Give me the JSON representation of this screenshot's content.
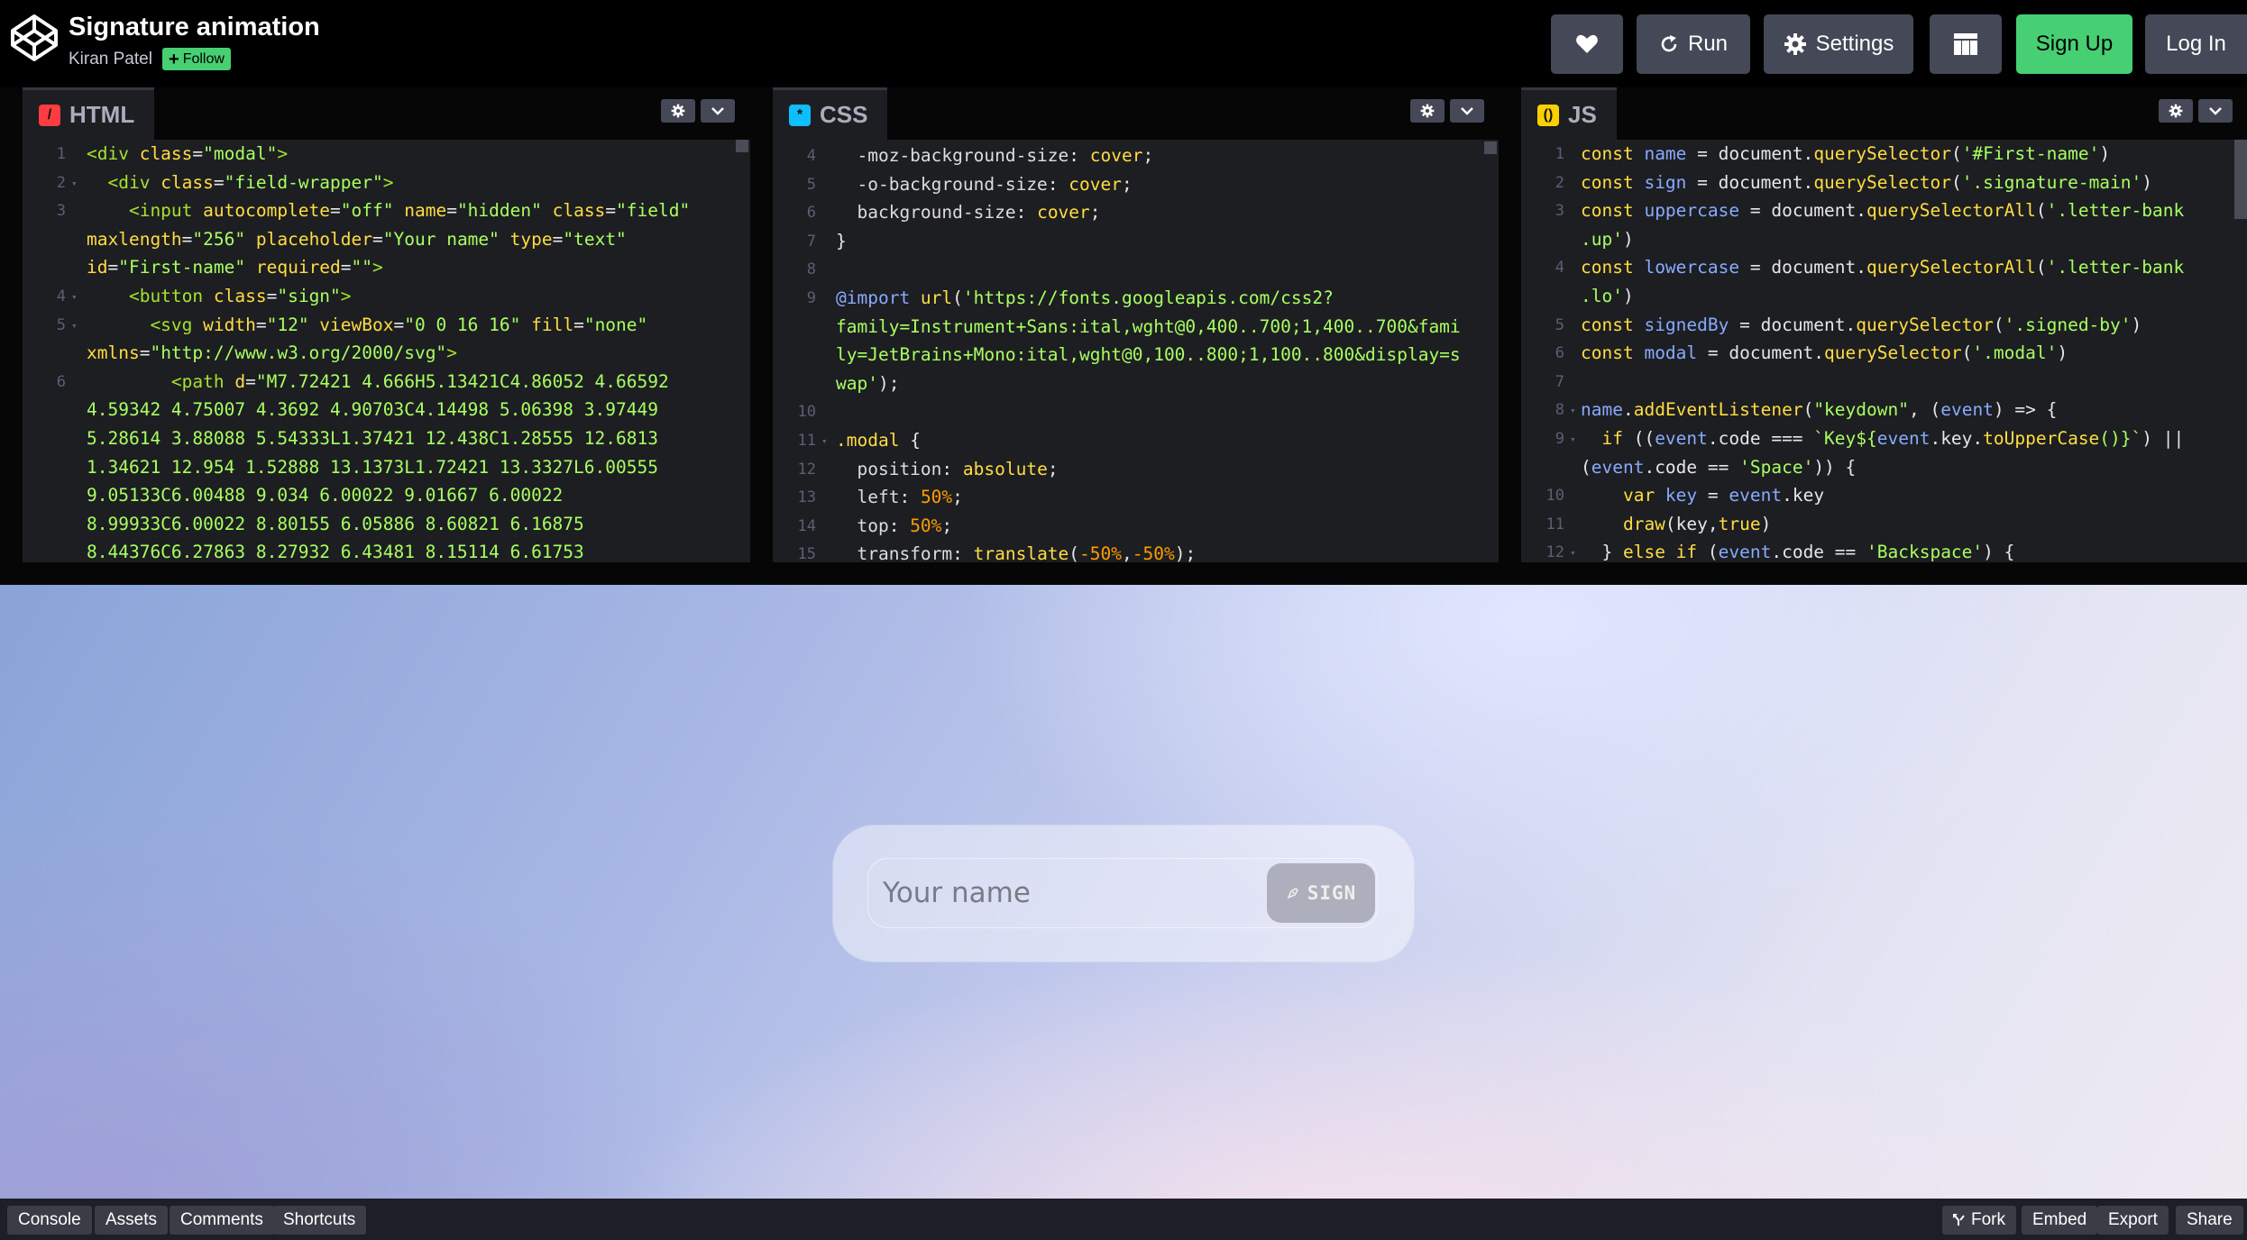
{
  "header": {
    "title": "Signature animation",
    "author": "Kiran Patel",
    "follow_label": "Follow",
    "buttons": {
      "run": "Run",
      "settings": "Settings",
      "signup": "Sign Up",
      "login": "Log In"
    },
    "accent": "#47cf73"
  },
  "editors": {
    "html": {
      "label": "HTML",
      "badge": "/",
      "lines": [
        {
          "n": "1",
          "fold": "",
          "segs": [
            [
              "<div ",
              "tk-tag"
            ],
            [
              "class",
              "tk-attr"
            ],
            [
              "=",
              ""
            ],
            [
              "\"modal\"",
              "tk-str"
            ],
            [
              ">",
              "tk-tag"
            ]
          ]
        },
        {
          "n": "2",
          "fold": "▾",
          "segs": [
            [
              "  <div ",
              "tk-tag"
            ],
            [
              "class",
              "tk-attr"
            ],
            [
              "=",
              ""
            ],
            [
              "\"field-wrapper\"",
              "tk-str"
            ],
            [
              ">",
              "tk-tag"
            ]
          ]
        },
        {
          "n": "3",
          "fold": "",
          "segs": [
            [
              "    <input ",
              "tk-tag"
            ],
            [
              "autocomplete",
              "tk-attr"
            ],
            [
              "=",
              ""
            ],
            [
              "\"off\"",
              "tk-str"
            ],
            [
              " name",
              "tk-attr"
            ],
            [
              "=",
              ""
            ],
            [
              "\"hidden\"",
              "tk-str"
            ],
            [
              " class",
              "tk-attr"
            ],
            [
              "=",
              ""
            ],
            [
              "\"field\"",
              "tk-str"
            ]
          ]
        },
        {
          "n": "",
          "fold": "",
          "segs": [
            [
              "maxlength",
              "tk-attr"
            ],
            [
              "=",
              ""
            ],
            [
              "\"256\"",
              "tk-str"
            ],
            [
              " placeholder",
              "tk-attr"
            ],
            [
              "=",
              ""
            ],
            [
              "\"Your name\"",
              "tk-str"
            ],
            [
              " type",
              "tk-attr"
            ],
            [
              "=",
              ""
            ],
            [
              "\"text\"",
              "tk-str"
            ]
          ]
        },
        {
          "n": "",
          "fold": "",
          "segs": [
            [
              "id",
              "tk-attr"
            ],
            [
              "=",
              ""
            ],
            [
              "\"First-name\"",
              "tk-str"
            ],
            [
              " required",
              "tk-attr"
            ],
            [
              "=",
              ""
            ],
            [
              "\"\"",
              "tk-str"
            ],
            [
              ">",
              "tk-tag"
            ]
          ]
        },
        {
          "n": "4",
          "fold": "▾",
          "segs": [
            [
              "    <button ",
              "tk-tag"
            ],
            [
              "class",
              "tk-attr"
            ],
            [
              "=",
              ""
            ],
            [
              "\"sign\"",
              "tk-str"
            ],
            [
              ">",
              "tk-tag"
            ]
          ]
        },
        {
          "n": "5",
          "fold": "▾",
          "segs": [
            [
              "      <svg ",
              "tk-tag"
            ],
            [
              "width",
              "tk-attr"
            ],
            [
              "=",
              ""
            ],
            [
              "\"12\"",
              "tk-str"
            ],
            [
              " viewBox",
              "tk-attr"
            ],
            [
              "=",
              ""
            ],
            [
              "\"0 0 16 16\"",
              "tk-str"
            ],
            [
              " fill",
              "tk-attr"
            ],
            [
              "=",
              ""
            ],
            [
              "\"none\"",
              "tk-str"
            ]
          ]
        },
        {
          "n": "",
          "fold": "",
          "segs": [
            [
              "xmlns",
              "tk-attr"
            ],
            [
              "=",
              ""
            ],
            [
              "\"http://www.w3.org/2000/svg\"",
              "tk-str"
            ],
            [
              ">",
              "tk-tag"
            ]
          ]
        },
        {
          "n": "6",
          "fold": "",
          "segs": [
            [
              "        <path ",
              "tk-tag"
            ],
            [
              "d",
              "tk-attr"
            ],
            [
              "=",
              ""
            ],
            [
              "\"M7.72421 4.666H5.13421C4.86052 4.66592",
              "tk-str"
            ]
          ]
        },
        {
          "n": "",
          "fold": "",
          "segs": [
            [
              "4.59342 4.75007 4.3692 4.90703C4.14498 5.06398 3.97449",
              "tk-str"
            ]
          ]
        },
        {
          "n": "",
          "fold": "",
          "segs": [
            [
              "5.28614 3.88088 5.54333L1.37421 12.438C1.28555 12.6813",
              "tk-str"
            ]
          ]
        },
        {
          "n": "",
          "fold": "",
          "segs": [
            [
              "1.34621 12.954 1.52888 13.1373L1.72421 13.3327L6.00555",
              "tk-str"
            ]
          ]
        },
        {
          "n": "",
          "fold": "",
          "segs": [
            [
              "9.05133C6.00488 9.034 6.00022 9.01667 6.00022",
              "tk-str"
            ]
          ]
        },
        {
          "n": "",
          "fold": "",
          "segs": [
            [
              "8.99933C6.00022 8.80155 6.05886 8.60821 6.16875",
              "tk-str"
            ]
          ]
        },
        {
          "n": "",
          "fold": "",
          "segs": [
            [
              "8.44376C6.27863 8.27932 6.43481 8.15114 6.61753",
              "tk-str"
            ]
          ]
        }
      ]
    },
    "css": {
      "label": "CSS",
      "badge": "*",
      "lines": [
        {
          "n": "4",
          "fold": "",
          "segs": [
            [
              "  -moz-background-size",
              "tk-prop"
            ],
            [
              ": ",
              ""
            ],
            [
              "cover",
              "tk-val"
            ],
            [
              ";",
              ""
            ]
          ]
        },
        {
          "n": "5",
          "fold": "",
          "segs": [
            [
              "  -o-background-size",
              "tk-prop"
            ],
            [
              ": ",
              ""
            ],
            [
              "cover",
              "tk-val"
            ],
            [
              ";",
              ""
            ]
          ]
        },
        {
          "n": "6",
          "fold": "",
          "segs": [
            [
              "  background-size",
              "tk-prop"
            ],
            [
              ": ",
              ""
            ],
            [
              "cover",
              "tk-val"
            ],
            [
              ";",
              ""
            ]
          ]
        },
        {
          "n": "7",
          "fold": "",
          "segs": [
            [
              "}",
              ""
            ]
          ]
        },
        {
          "n": "8",
          "fold": "",
          "segs": [
            [
              "",
              ""
            ]
          ]
        },
        {
          "n": "9",
          "fold": "",
          "segs": [
            [
              "@import ",
              "tk-var"
            ],
            [
              "url",
              "tk-fn"
            ],
            [
              "(",
              ""
            ],
            [
              "'https://fonts.googleapis.com/css2?",
              "tk-str"
            ]
          ]
        },
        {
          "n": "",
          "fold": "",
          "segs": [
            [
              "family=Instrument+Sans:ital,wght@0,400..700;1,400..700&fami",
              "tk-str"
            ]
          ]
        },
        {
          "n": "",
          "fold": "",
          "segs": [
            [
              "ly=JetBrains+Mono:ital,wght@0,100..800;1,100..800&display=s",
              "tk-str"
            ]
          ]
        },
        {
          "n": "",
          "fold": "",
          "segs": [
            [
              "wap'",
              "tk-str"
            ],
            [
              ");",
              ""
            ]
          ]
        },
        {
          "n": "10",
          "fold": "",
          "segs": [
            [
              "",
              ""
            ]
          ]
        },
        {
          "n": "11",
          "fold": "▾",
          "segs": [
            [
              ".modal",
              "tk-sel"
            ],
            [
              " {",
              ""
            ]
          ]
        },
        {
          "n": "12",
          "fold": "",
          "segs": [
            [
              "  position",
              "tk-prop"
            ],
            [
              ": ",
              ""
            ],
            [
              "absolute",
              "tk-val"
            ],
            [
              ";",
              ""
            ]
          ]
        },
        {
          "n": "13",
          "fold": "",
          "segs": [
            [
              "  left",
              "tk-prop"
            ],
            [
              ": ",
              ""
            ],
            [
              "50%",
              "tk-num"
            ],
            [
              ";",
              ""
            ]
          ]
        },
        {
          "n": "14",
          "fold": "",
          "segs": [
            [
              "  top",
              "tk-prop"
            ],
            [
              ": ",
              ""
            ],
            [
              "50%",
              "tk-num"
            ],
            [
              ";",
              ""
            ]
          ]
        },
        {
          "n": "15",
          "fold": "",
          "segs": [
            [
              "  transform",
              "tk-prop"
            ],
            [
              ": ",
              ""
            ],
            [
              "translate",
              "tk-fn"
            ],
            [
              "(",
              ""
            ],
            [
              "-50%",
              "tk-num"
            ],
            [
              ",",
              ""
            ],
            [
              "-50%",
              "tk-num"
            ],
            [
              ");",
              ""
            ]
          ]
        }
      ]
    },
    "js": {
      "label": "JS",
      "badge": "()",
      "lines": [
        {
          "n": "1",
          "fold": "",
          "segs": [
            [
              "const ",
              "tk-kw"
            ],
            [
              "name",
              "tk-var"
            ],
            [
              " = document.",
              ""
            ],
            [
              "querySelector",
              "tk-fn"
            ],
            [
              "(",
              ""
            ],
            [
              "'#First-name'",
              "tk-str"
            ],
            [
              ")",
              ""
            ]
          ]
        },
        {
          "n": "2",
          "fold": "",
          "segs": [
            [
              "const ",
              "tk-kw"
            ],
            [
              "sign",
              "tk-var"
            ],
            [
              " = document.",
              ""
            ],
            [
              "querySelector",
              "tk-fn"
            ],
            [
              "(",
              ""
            ],
            [
              "'.signature-main'",
              "tk-str"
            ],
            [
              ")",
              ""
            ]
          ]
        },
        {
          "n": "3",
          "fold": "",
          "segs": [
            [
              "const ",
              "tk-kw"
            ],
            [
              "uppercase",
              "tk-var"
            ],
            [
              " = document.",
              ""
            ],
            [
              "querySelectorAll",
              "tk-fn"
            ],
            [
              "(",
              ""
            ],
            [
              "'.letter-bank",
              "tk-str"
            ]
          ]
        },
        {
          "n": "",
          "fold": "",
          "segs": [
            [
              ".up'",
              "tk-str"
            ],
            [
              ")",
              ""
            ]
          ]
        },
        {
          "n": "4",
          "fold": "",
          "segs": [
            [
              "const ",
              "tk-kw"
            ],
            [
              "lowercase",
              "tk-var"
            ],
            [
              " = document.",
              ""
            ],
            [
              "querySelectorAll",
              "tk-fn"
            ],
            [
              "(",
              ""
            ],
            [
              "'.letter-bank",
              "tk-str"
            ]
          ]
        },
        {
          "n": "",
          "fold": "",
          "segs": [
            [
              ".lo'",
              "tk-str"
            ],
            [
              ")",
              ""
            ]
          ]
        },
        {
          "n": "5",
          "fold": "",
          "segs": [
            [
              "const ",
              "tk-kw"
            ],
            [
              "signedBy",
              "tk-var"
            ],
            [
              " = document.",
              ""
            ],
            [
              "querySelector",
              "tk-fn"
            ],
            [
              "(",
              ""
            ],
            [
              "'.signed-by'",
              "tk-str"
            ],
            [
              ")",
              ""
            ]
          ]
        },
        {
          "n": "6",
          "fold": "",
          "segs": [
            [
              "const ",
              "tk-kw"
            ],
            [
              "modal",
              "tk-var"
            ],
            [
              " = document.",
              ""
            ],
            [
              "querySelector",
              "tk-fn"
            ],
            [
              "(",
              ""
            ],
            [
              "'.modal'",
              "tk-str"
            ],
            [
              ")",
              ""
            ]
          ]
        },
        {
          "n": "7",
          "fold": "",
          "segs": [
            [
              "",
              ""
            ]
          ]
        },
        {
          "n": "8",
          "fold": "▾",
          "segs": [
            [
              "name",
              "tk-var"
            ],
            [
              ".",
              ""
            ],
            [
              "addEventListener",
              "tk-fn"
            ],
            [
              "(",
              ""
            ],
            [
              "\"keydown\"",
              "tk-str"
            ],
            [
              ", (",
              ""
            ],
            [
              "event",
              "tk-var"
            ],
            [
              ") => {",
              ""
            ]
          ]
        },
        {
          "n": "9",
          "fold": "▾",
          "segs": [
            [
              "  if ",
              "tk-kw"
            ],
            [
              "((",
              ""
            ],
            [
              "event",
              "tk-var"
            ],
            [
              ".code === ",
              ""
            ],
            [
              "`Key${",
              "tk-str"
            ],
            [
              "event",
              "tk-var"
            ],
            [
              ".key.",
              ""
            ],
            [
              "toUpperCase",
              "tk-fn"
            ],
            [
              "()}`",
              "tk-str"
            ],
            [
              ") ||",
              ""
            ]
          ]
        },
        {
          "n": "",
          "fold": "",
          "segs": [
            [
              "(",
              ""
            ],
            [
              "event",
              "tk-var"
            ],
            [
              ".code == ",
              ""
            ],
            [
              "'Space'",
              "tk-str"
            ],
            [
              ")) {",
              ""
            ]
          ]
        },
        {
          "n": "10",
          "fold": "",
          "segs": [
            [
              "    var ",
              "tk-kw"
            ],
            [
              "key",
              "tk-var"
            ],
            [
              " = ",
              ""
            ],
            [
              "event",
              "tk-var"
            ],
            [
              ".key",
              ""
            ]
          ]
        },
        {
          "n": "11",
          "fold": "",
          "segs": [
            [
              "    draw",
              "tk-fn"
            ],
            [
              "(key,",
              ""
            ],
            [
              "true",
              "tk-kw"
            ],
            [
              ")",
              ""
            ]
          ]
        },
        {
          "n": "12",
          "fold": "▾",
          "segs": [
            [
              "  } ",
              ""
            ],
            [
              "else if ",
              "tk-kw"
            ],
            [
              "(",
              ""
            ],
            [
              "event",
              "tk-var"
            ],
            [
              ".code == ",
              ""
            ],
            [
              "'Backspace'",
              "tk-str"
            ],
            [
              ") {",
              ""
            ]
          ]
        }
      ]
    }
  },
  "preview": {
    "input_placeholder": "Your name",
    "sign_label": "SIGN"
  },
  "footer": {
    "left": [
      "Console",
      "Assets",
      "Comments",
      "Shortcuts"
    ],
    "right": {
      "fork": "Fork",
      "embed": "Embed",
      "export": "Export",
      "share": "Share"
    }
  }
}
